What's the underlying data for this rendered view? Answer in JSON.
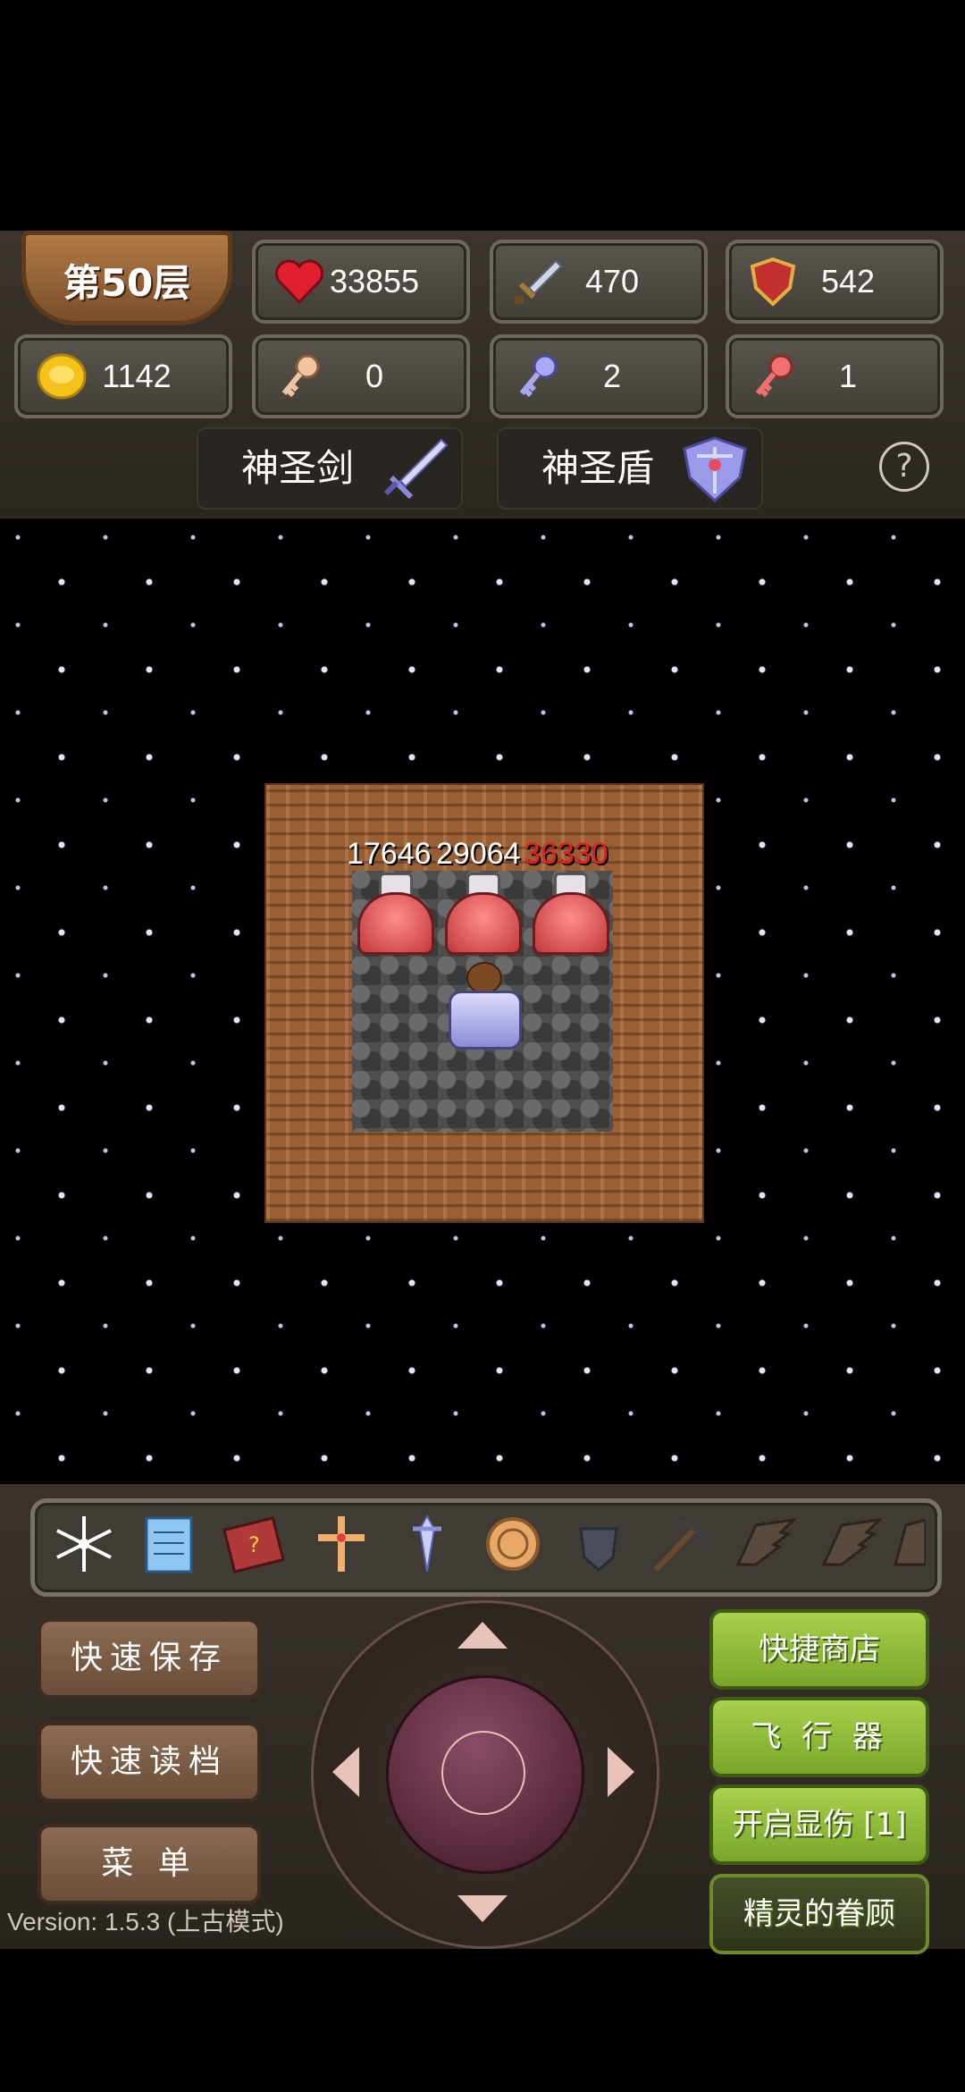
{
  "hud": {
    "floor_label": "第50层",
    "hp": "33855",
    "attack": "470",
    "defense": "542",
    "gold": "1142",
    "yellow_keys": "0",
    "blue_keys": "2",
    "red_keys": "1",
    "help": "?"
  },
  "equipment": {
    "weapon_name": "神圣剑",
    "shield_name": "神圣盾"
  },
  "battle": {
    "damage_left": "17646",
    "damage_middle": "29064",
    "damage_right": "36330",
    "colors": {
      "normal": "#ffffff",
      "lethal": "#ff2020"
    }
  },
  "toolbar": {
    "items": [
      "snowflake-icon",
      "notebook-icon",
      "monster-book-icon",
      "holy-cross-icon",
      "holy-water-icon",
      "coin-icon",
      "bomb-icon",
      "pickaxe-icon",
      "wing-icon",
      "wing-icon",
      "wing-icon"
    ]
  },
  "buttons": {
    "quick_save": "快速保存",
    "quick_load": "快速读档",
    "menu": "菜 单",
    "quick_shop": "快捷商店",
    "fly": "飞 行 器",
    "show_damage": "开启显伤 [1]",
    "fairy": "精灵的眷顾"
  },
  "footer": {
    "version": "Version: 1.5.3 (上古模式)"
  }
}
